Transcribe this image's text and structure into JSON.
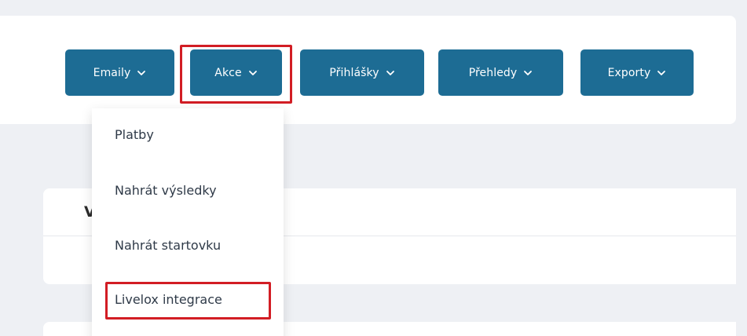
{
  "toolbar": {
    "buttons": [
      {
        "label": "Emaily"
      },
      {
        "label": "Akce"
      },
      {
        "label": "Přihlášky"
      },
      {
        "label": "Přehledy"
      },
      {
        "label": "Exporty"
      }
    ]
  },
  "card": {
    "title_fragment": "V"
  },
  "dropdown": {
    "items": [
      {
        "label": "Platby"
      },
      {
        "label": "Nahrát výsledky"
      },
      {
        "label": "Nahrát startovku"
      },
      {
        "label": "Livelox integrace"
      }
    ]
  },
  "colors": {
    "button_bg": "#1d6c94",
    "highlight": "#d21d24",
    "page_bg": "#eef0f4"
  },
  "icons": {
    "button_chevron": "chevron-down-icon"
  }
}
